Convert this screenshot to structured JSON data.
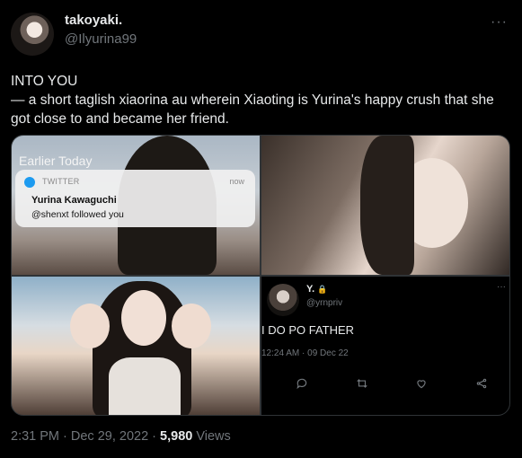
{
  "author": {
    "name": "takoyaki.",
    "handle": "@Ilyurina99"
  },
  "tweet": {
    "text": "INTO YOU\n— a short taglish xiaorina au wherein Xiaoting is Yurina's happy crush that she got close to and became her friend."
  },
  "media": {
    "notification": {
      "header": "Earlier Today",
      "app": "TWITTER",
      "time": "now",
      "title": "Yurina Kawaguchi",
      "body": "@shenxt followed you"
    },
    "embedded_tweet": {
      "name": "Y.",
      "handle": "@yrnpriv",
      "text": "I DO PO FATHER",
      "timestamp": "12:24 AM · 09 Dec 22"
    }
  },
  "meta": {
    "timestamp": "2:31 PM · Dec 29, 2022 · ",
    "views_count": "5,980",
    "views_label": " Views"
  },
  "icons": {
    "more": "more-dots-icon",
    "lock": "lock-icon",
    "reply": "reply-icon",
    "retweet": "retweet-icon",
    "like": "heart-icon",
    "share": "share-icon"
  },
  "colors": {
    "background": "#000000",
    "text": "#e7e9ea",
    "muted": "#71767b",
    "twitter_blue": "#1d9bf0"
  }
}
